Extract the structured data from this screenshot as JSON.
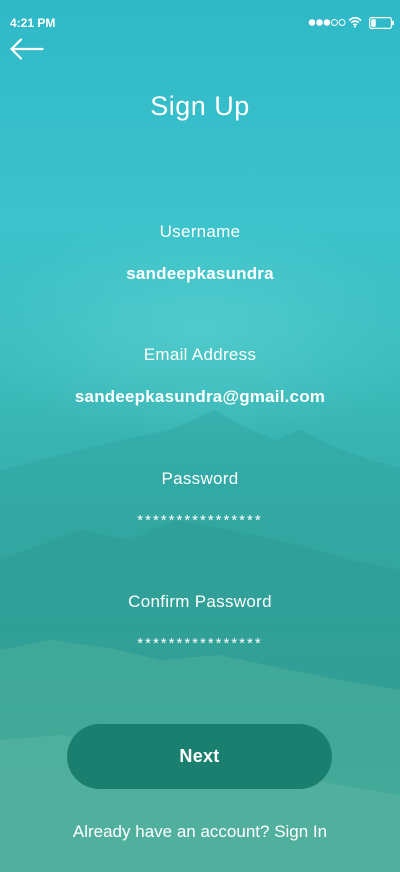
{
  "status_bar": {
    "time": "4:21 PM",
    "signal_icon": "signal-dots-icon",
    "wifi_icon": "wifi-icon",
    "battery_icon": "battery-icon"
  },
  "header": {
    "back_icon": "arrow-left-icon",
    "title": "Sign Up"
  },
  "form": {
    "username": {
      "label": "Username",
      "value": "sandeepkasundra"
    },
    "email": {
      "label": "Email Address",
      "value": "sandeepkasundra@gmail.com"
    },
    "password": {
      "label": "Password",
      "value": "****************"
    },
    "confirm_password": {
      "label": "Confirm Password",
      "value": "****************"
    }
  },
  "actions": {
    "next_label": "Next",
    "signin_prompt": "Already have an account? ",
    "signin_link": "Sign In"
  },
  "colors": {
    "background_top": "#2fb8c7",
    "background_bottom": "#4ab09e",
    "button": "#1b7f70",
    "text": "#ffffff"
  }
}
